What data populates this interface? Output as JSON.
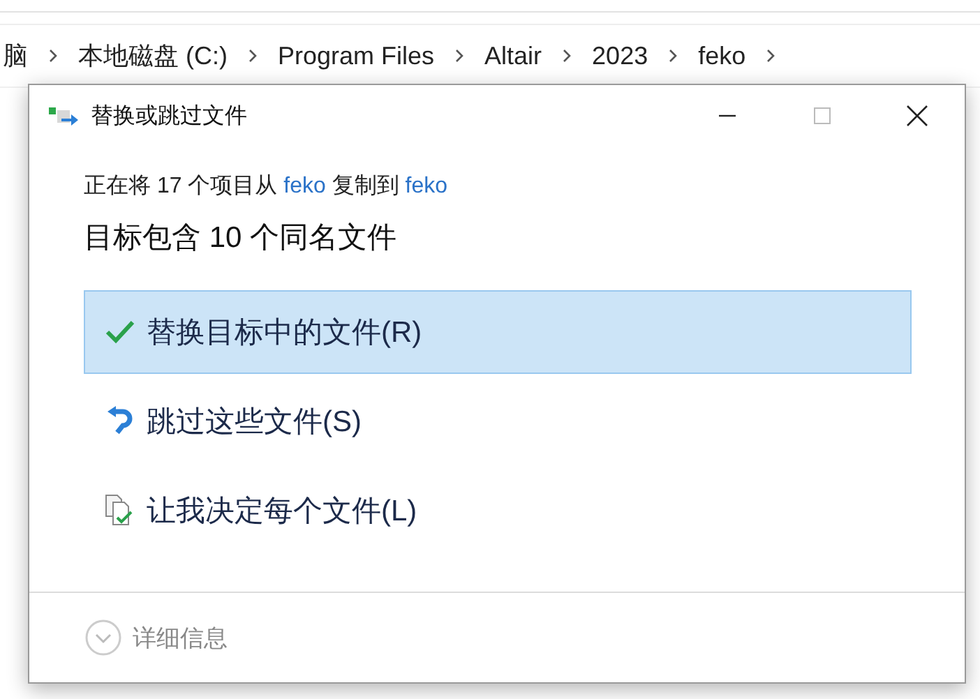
{
  "breadcrumb": [
    "脑",
    "本地磁盘 (C:)",
    "Program Files",
    "Altair",
    "2023",
    "feko"
  ],
  "dialog": {
    "title": "替换或跳过文件",
    "status": "正在将 17 个项目从 **feko** 复制到 **feko**",
    "heading": "目标包含 10 个同名文件",
    "options": [
      {
        "kind": "replace",
        "label": "替换目标中的文件(R)",
        "selected": true
      },
      {
        "kind": "skip",
        "label": "跳过这些文件(S)",
        "selected": false
      },
      {
        "kind": "decide",
        "label": "让我决定每个文件(L)",
        "selected": false
      }
    ],
    "details": {
      "label": "详细信息",
      "expanded": false
    }
  }
}
